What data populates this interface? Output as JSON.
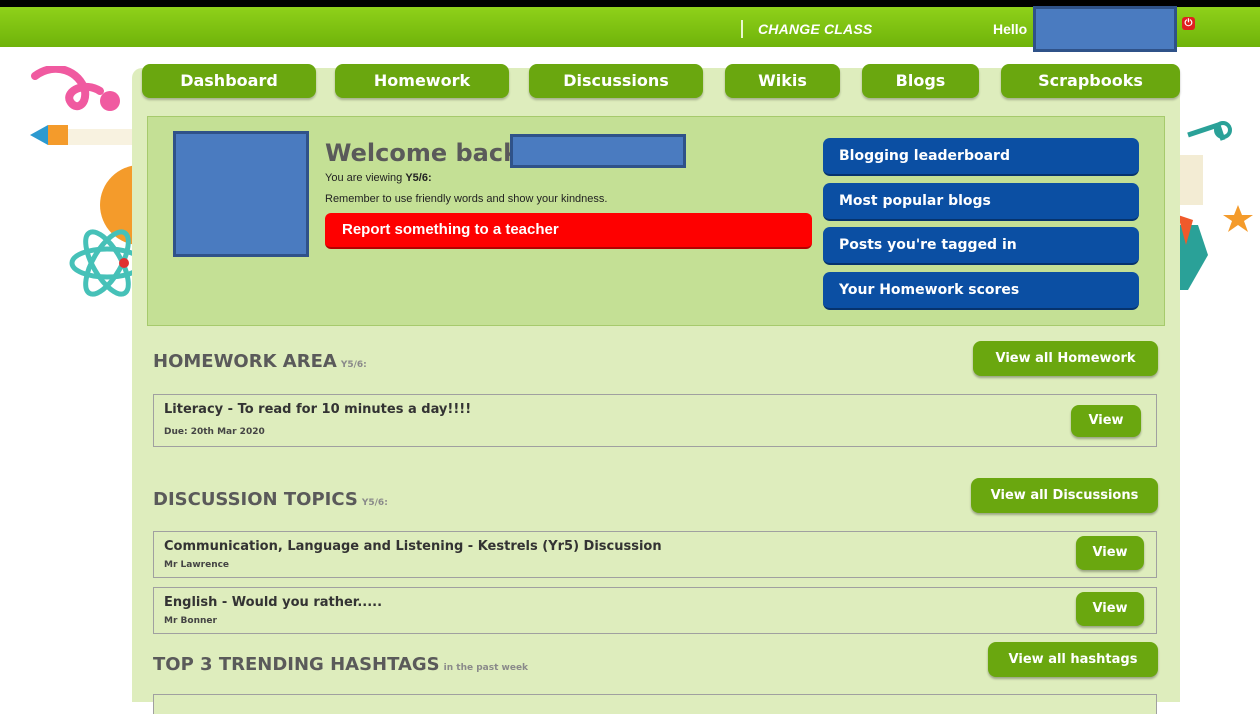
{
  "header": {
    "change_class": "CHANGE CLASS",
    "hello": "Hello",
    "power_icon": "power-icon"
  },
  "tabs": [
    {
      "label": "Dashboard"
    },
    {
      "label": "Homework"
    },
    {
      "label": "Discussions"
    },
    {
      "label": "Wikis"
    },
    {
      "label": "Blogs"
    },
    {
      "label": "Scrapbooks"
    }
  ],
  "welcome": {
    "title": "Welcome back",
    "viewing_prefix": "You are viewing",
    "viewing_class": "Y5/6:",
    "remember": "Remember to use friendly words and show your kindness.",
    "report_button": "Report something to a teacher"
  },
  "side_buttons": [
    {
      "label": "Blogging leaderboard"
    },
    {
      "label": "Most popular blogs"
    },
    {
      "label": "Posts you're tagged in"
    },
    {
      "label": "Your Homework scores"
    }
  ],
  "homework": {
    "title": "HOMEWORK AREA",
    "class": "Y5/6:",
    "view_all": "View all Homework",
    "items": [
      {
        "title": "Literacy - To read for 10 minutes a day!!!!",
        "sub": "Due: 20th Mar 2020",
        "button": "View"
      }
    ]
  },
  "discussions": {
    "title": "DISCUSSION TOPICS",
    "class": "Y5/6:",
    "view_all": "View all Discussions",
    "items": [
      {
        "title": "Communication, Language and Listening - Kestrels (Yr5) Discussion",
        "sub": "Mr Lawrence",
        "button": "View"
      },
      {
        "title": "English - Would you rather.....",
        "sub": "Mr Bonner",
        "button": "View"
      }
    ]
  },
  "hashtags": {
    "title": "TOP 3 TRENDING HASHTAGS",
    "sub": "in the past week",
    "view_all": "View all hashtags"
  },
  "colors": {
    "topbar": "#7cc213",
    "tab_green": "#6aa70f",
    "panel_bg": "#deedbd",
    "side_blue": "#0b4fa3",
    "report_red": "#fe0000"
  }
}
